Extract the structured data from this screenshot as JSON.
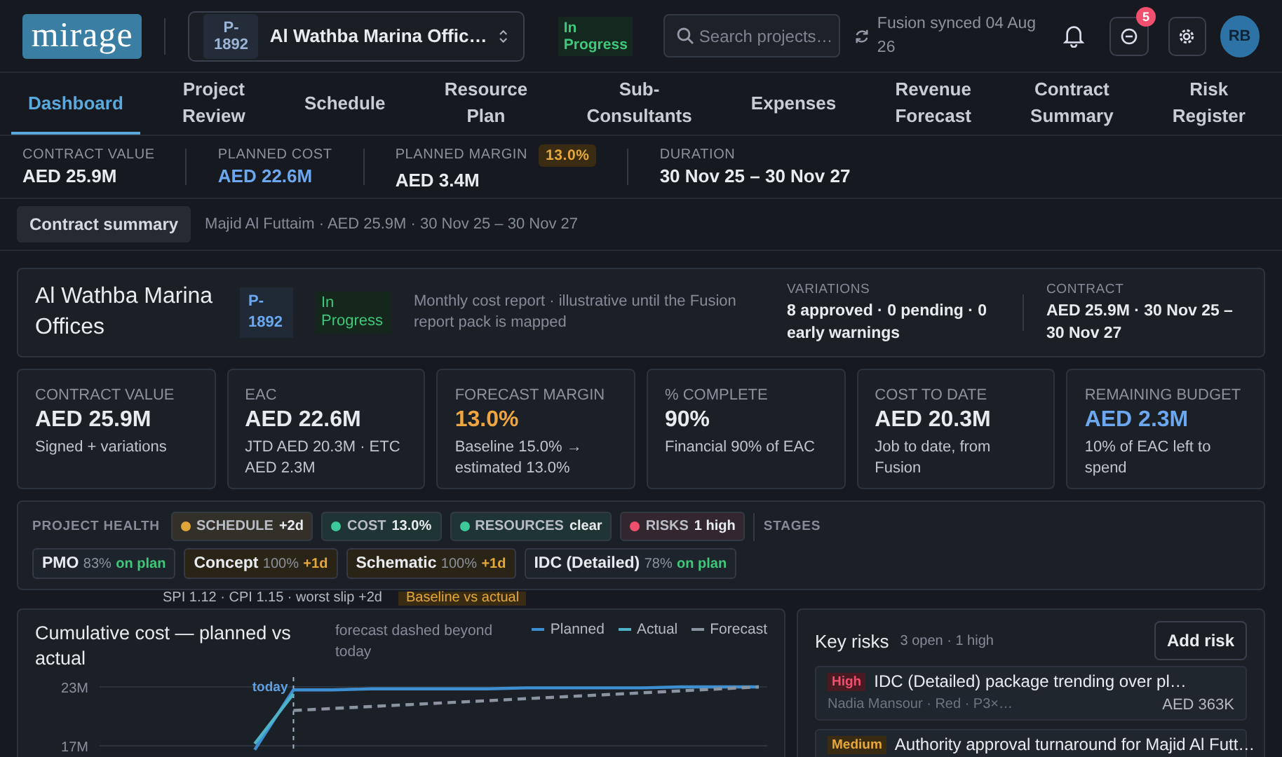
{
  "header": {
    "logo": "mirage",
    "project_code": "P-1892",
    "project_name": "Al Wathba Marina Offic…",
    "status": "In Progress",
    "search": {
      "placeholder": "Search projects…"
    },
    "sync": "Fusion synced 04 Aug 26",
    "notification_count": "5",
    "avatar": "RB"
  },
  "tabs": [
    {
      "label": "Dashboard",
      "selected": true
    },
    {
      "label": "Project Review",
      "selected": false
    },
    {
      "label": "Schedule",
      "selected": false
    },
    {
      "label": "Resource Plan",
      "selected": false
    },
    {
      "label": "Sub-Consultants",
      "selected": false
    },
    {
      "label": "Expenses",
      "selected": false
    },
    {
      "label": "Revenue Forecast",
      "selected": false
    },
    {
      "label": "Contract Summary",
      "selected": false
    },
    {
      "label": "Risk Register",
      "selected": false
    }
  ],
  "summary_strip": [
    {
      "label": "CONTRACT VALUE",
      "value": "AED 25.9M",
      "kind": "default"
    },
    {
      "label": "PLANNED COST",
      "value": "AED 22.6M",
      "kind": "accent"
    },
    {
      "label": "PLANNED MARGIN",
      "badge": "13.0%",
      "value": "AED 3.4M",
      "kind": "default"
    },
    {
      "label": "DURATION",
      "value": "30 Nov 25 – 30 Nov 27",
      "kind": "default"
    }
  ],
  "contract_bar": {
    "button": "Contract summary",
    "details": "Majid Al Futtaim · AED 25.9M · 30 Nov 25 – 30 Nov 27"
  },
  "project_card": {
    "title": "Al Wathba Marina Offices",
    "code": "P-1892",
    "status": "In Progress",
    "note": "Monthly cost report · illustrative until the Fusion report pack is mapped",
    "variations_label": "VARIATIONS",
    "variations": "8 approved · 0 pending · 0 early warnings",
    "contract_label": "CONTRACT",
    "contract": "AED 25.9M · 30 Nov 25 – 30 Nov 27"
  },
  "kpis": [
    {
      "label": "CONTRACT VALUE",
      "value": "AED 25.9M",
      "sub": "Signed + variations",
      "kind": "default"
    },
    {
      "label": "EAC",
      "value": "AED 22.6M",
      "sub": "JTD AED 20.3M · ETC AED 2.3M",
      "kind": "default"
    },
    {
      "label": "FORECAST MARGIN",
      "value": "13.0%",
      "sub": "Baseline 15.0% → estimated 13.0%",
      "kind": "warning"
    },
    {
      "label": "% COMPLETE",
      "value": "90%",
      "sub": "Financial 90% of EAC",
      "kind": "default"
    },
    {
      "label": "COST TO DATE",
      "value": "AED 20.3M",
      "sub": "Job to date, from Fusion",
      "kind": "default"
    },
    {
      "label": "REMAINING BUDGET",
      "value": "AED 2.3M",
      "sub": "10% of EAC left to spend",
      "kind": "accent"
    }
  ],
  "health": {
    "label": "PROJECT HEALTH",
    "stages_label": "STAGES",
    "chips": [
      {
        "label": "SCHEDULE",
        "value": "+2d",
        "color": "#e0a53a"
      },
      {
        "label": "COST",
        "value": "13.0%",
        "color": "#3ec99a"
      },
      {
        "label": "RESOURCES",
        "value": "clear",
        "color": "#3ec99a"
      },
      {
        "label": "RISKS",
        "value": "1 high",
        "color": "#f0506e"
      }
    ],
    "stages": [
      {
        "name": "PMO",
        "percent": "83%",
        "status": "on plan",
        "kind": "on_plan"
      },
      {
        "name": "Concept",
        "percent": "100%",
        "status": "+1d",
        "kind": "late"
      },
      {
        "name": "Schematic",
        "percent": "100%",
        "status": "+1d",
        "kind": "late"
      },
      {
        "name": "IDC (Detailed)",
        "percent": "78%",
        "status": "on plan",
        "kind": "on_plan"
      }
    ]
  },
  "performance": {
    "text": "SPI 1.12 · CPI 1.15 · worst slip +2d",
    "tag": "Baseline vs actual"
  },
  "cost_chart": {
    "title": "Cumulative cost — planned vs actual",
    "note": "forecast dashed beyond today",
    "today_label": "today",
    "chart_data": {
      "type": "line",
      "categories": [
        null,
        null,
        null,
        null,
        null,
        null,
        null,
        null,
        null,
        null,
        null,
        null,
        null,
        null,
        null,
        null,
        null,
        null
      ],
      "ylim": [
        16.5,
        24
      ],
      "yticks": [
        {
          "value": 23,
          "label": "23M"
        },
        {
          "value": 17,
          "label": "17M"
        }
      ],
      "series": [
        {
          "name": "Planned",
          "color": "#3d8fd1",
          "line_style": "solid",
          "values": [
            null,
            null,
            null,
            null,
            16.6,
            22.7,
            22.7,
            22.8,
            22.8,
            22.8,
            22.8,
            22.9,
            22.9,
            22.9,
            22.9,
            23,
            23,
            23
          ]
        },
        {
          "name": "Actual",
          "color": "#4fb3c8",
          "line_style": "solid",
          "values": [
            null,
            null,
            null,
            null,
            17.2,
            22.3,
            null,
            null,
            null,
            null,
            null,
            null,
            null,
            null,
            null,
            null,
            null,
            null
          ]
        },
        {
          "name": "Forecast",
          "color": "#8a93a0",
          "line_style": "dashed",
          "values": [
            null,
            null,
            null,
            null,
            null,
            20.6,
            20.8,
            21,
            21.2,
            21.4,
            21.6,
            21.8,
            22,
            22.2,
            22.4,
            22.6,
            22.8,
            23
          ]
        }
      ]
    }
  },
  "risks": {
    "title": "Key risks",
    "summary": "3 open · 1 high",
    "add_button": "Add risk",
    "items": [
      {
        "level": "High",
        "kind": "high",
        "title": "IDC (Detailed) package trending over pl…",
        "meta": "Nadia Mansour · Red · P3×…",
        "amount": "AED 363K"
      },
      {
        "level": "Medium",
        "kind": "medium",
        "title": "Authority approval turnaround for Majid Al Futt…"
      }
    ]
  }
}
